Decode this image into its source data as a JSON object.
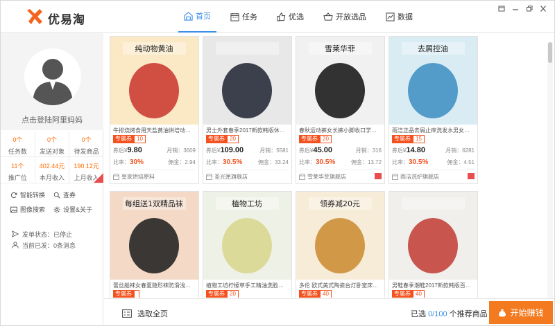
{
  "app": {
    "name": "优易淘"
  },
  "nav": [
    {
      "label": "首页",
      "icon": "home-icon",
      "active": true
    },
    {
      "label": "任务",
      "icon": "calendar-icon",
      "active": false
    },
    {
      "label": "优选",
      "icon": "thumbs-up-icon",
      "active": false
    },
    {
      "label": "开放选品",
      "icon": "basket-icon",
      "active": false
    },
    {
      "label": "数据",
      "icon": "chart-icon",
      "active": false
    }
  ],
  "sidebar": {
    "login_text": "点击登陆阿里妈妈",
    "stats": [
      {
        "value": "0个",
        "label": "任务数"
      },
      {
        "value": "0个",
        "label": "发送对象"
      },
      {
        "value": "0个",
        "label": "待发商品"
      },
      {
        "value": "11个",
        "label": "推广位"
      },
      {
        "value": "402.44元",
        "label": "本月收入"
      },
      {
        "value": "190.12元",
        "label": "上月收入"
      }
    ],
    "tools": [
      {
        "label": "智能转换",
        "icon": "refresh-icon"
      },
      {
        "label": "查券",
        "icon": "search-icon"
      },
      {
        "label": "图像搜索",
        "icon": "image-search-icon"
      },
      {
        "label": "设置&关于",
        "icon": "gear-icon"
      }
    ],
    "status": [
      {
        "label": "发单状态：已停止",
        "icon": "send-icon"
      },
      {
        "label": "当前已发：0条消息",
        "icon": "user-icon"
      }
    ]
  },
  "products": [
    {
      "title": "牛排烧烤食用天盐黄油烘培动物性黄油",
      "coupon": "10",
      "price": "9.80",
      "monthly": "3609",
      "rate": "30%",
      "commission": "2.94",
      "shop": "皇家烘焙原料",
      "flag": false,
      "price_label": "券后¥",
      "monthly_label": "月销：",
      "rate_label": "比率：",
      "comm_label": "佣金：",
      "img_text": "纯动物黄油",
      "img_colors": [
        "#fbe9c5",
        "#c9332b"
      ]
    },
    {
      "title": "男士外套春季2017新款韩版休闲潮流帅气",
      "coupon": "20",
      "price": "109.00",
      "monthly": "5581",
      "rate": "30.5%",
      "commission": "33.24",
      "shop": "圣光匣旗舰店",
      "flag": false,
      "price_label": "券后¥",
      "monthly_label": "月销：",
      "rate_label": "比率：",
      "comm_label": "佣金：",
      "img_text": "",
      "img_colors": [
        "#e8e8e8",
        "#1d2230"
      ]
    },
    {
      "title": "春秋运动裤女长裤小脚收口学生宽松大码",
      "coupon": "20",
      "price": "45.00",
      "monthly": "316",
      "rate": "30.5%",
      "commission": "13.72",
      "shop": "雪莱华菲旗舰店",
      "flag": true,
      "price_label": "券后¥",
      "monthly_label": "月销：",
      "rate_label": "比率：",
      "comm_label": "佣金：",
      "img_text": "雪莱华菲",
      "img_colors": [
        "#f1f1f1",
        "#111111"
      ]
    },
    {
      "title": "雨洁正品去屑止痒洗发水男女持久留香控",
      "coupon": "15",
      "price": "14.80",
      "monthly": "6281",
      "rate": "30.5%",
      "commission": "4.51",
      "shop": "雨洁洗护旗舰店",
      "flag": true,
      "price_label": "券后¥",
      "monthly_label": "月销：",
      "rate_label": "比率：",
      "comm_label": "佣金：",
      "img_text": "去屑控油",
      "img_colors": [
        "#d9ecf4",
        "#3b8ec2"
      ]
    },
    {
      "title": "蕾丝船袜女春夏隐形袜防滑浅口纯棉",
      "coupon": "",
      "price": "",
      "monthly": "",
      "rate": "",
      "commission": "",
      "shop": "",
      "flag": false,
      "price_label": "",
      "monthly_label": "",
      "rate_label": "",
      "comm_label": "",
      "img_text": "每组送1双精品袜",
      "img_colors": [
        "#f3d9c6",
        "#1a1a1a"
      ]
    },
    {
      "title": "植物工坊柠檬草手工精油洗脸冷香皂",
      "coupon": "20",
      "price": "",
      "monthly": "",
      "rate": "",
      "commission": "",
      "shop": "",
      "flag": false,
      "price_label": "",
      "monthly_label": "",
      "rate_label": "",
      "comm_label": "",
      "img_text": "植物工坊",
      "img_colors": [
        "#eef2e6",
        "#d8d68a"
      ]
    },
    {
      "title": "多伦 欧式美式陶瓷台灯卧室床头灯",
      "coupon": "40",
      "price": "",
      "monthly": "",
      "rate": "",
      "commission": "",
      "shop": "",
      "flag": false,
      "price_label": "",
      "monthly_label": "",
      "rate_label": "",
      "comm_label": "",
      "img_text": "领券减20元",
      "img_colors": [
        "#f7ecd8",
        "#c98a2e"
      ]
    },
    {
      "title": "男鞋春季潮鞋2017新款韩版百搭小白鞋",
      "coupon": "40",
      "price": "",
      "monthly": "",
      "rate": "",
      "commission": "",
      "shop": "",
      "flag": false,
      "price_label": "",
      "monthly_label": "",
      "rate_label": "",
      "comm_label": "",
      "img_text": "",
      "img_colors": [
        "#f0efec",
        "#c23a34"
      ]
    }
  ],
  "coupon_tag": "专属券",
  "footer": {
    "select_all": "选取全页",
    "selected_prefix": "已选",
    "selected_count": "0/100",
    "selected_suffix": "个推荐商品",
    "start_button": "开始赚钱"
  }
}
